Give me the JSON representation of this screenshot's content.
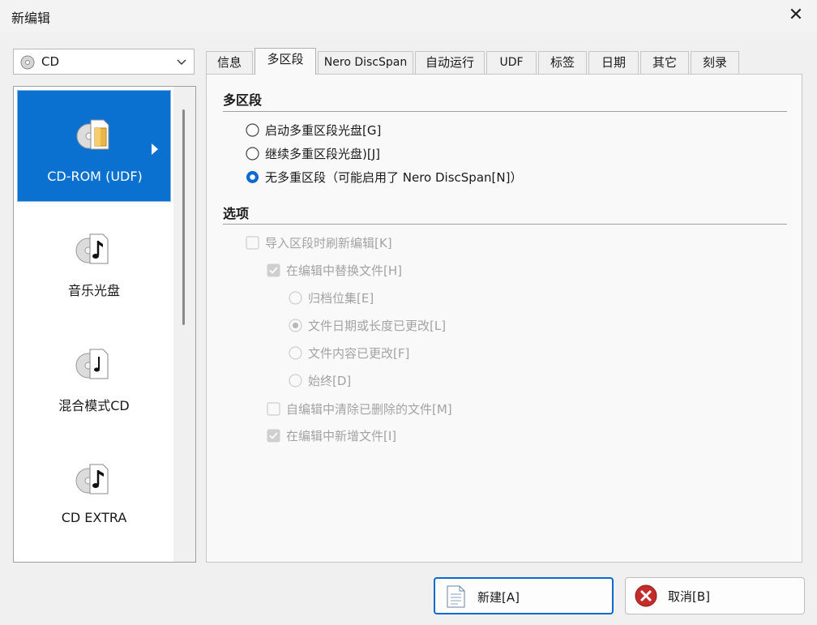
{
  "window": {
    "title": "新编辑",
    "close_symbol": "✕"
  },
  "disc_type": {
    "selected": "CD"
  },
  "categories": [
    {
      "label": "CD-ROM (UDF)",
      "icon": "cd-folder-icon",
      "selected": true
    },
    {
      "label": "音乐光盘",
      "icon": "cd-music-icon",
      "selected": false
    },
    {
      "label": "混合模式CD",
      "icon": "cd-mixed-icon",
      "selected": false
    },
    {
      "label": "CD EXTRA",
      "icon": "cd-extra-icon",
      "selected": false
    }
  ],
  "tabs": [
    "信息",
    "多区段",
    "Nero DiscSpan",
    "自动运行",
    "UDF",
    "标签",
    "日期",
    "其它",
    "刻录"
  ],
  "active_tab": "多区段",
  "multisession": {
    "heading": "多区段",
    "options": [
      {
        "label": "启动多重区段光盘[G]",
        "checked": false
      },
      {
        "label": "继续多重区段光盘)[J]",
        "checked": false
      },
      {
        "label": "无多重区段（可能启用了 Nero DiscSpan[N]）",
        "checked": true
      }
    ]
  },
  "options": {
    "heading": "选项",
    "refresh_on_import": {
      "label": "导入区段时刷新编辑[K]",
      "checked": false
    },
    "replace_files": {
      "label": "在编辑中替换文件[H]",
      "checked": true
    },
    "replace_modes": [
      {
        "label": "归档位集[E]",
        "checked": false
      },
      {
        "label": "文件日期或长度已更改[L]",
        "checked": true
      },
      {
        "label": "文件内容已更改[F]",
        "checked": false
      },
      {
        "label": "始终[D]",
        "checked": false
      }
    ],
    "remove_deleted": {
      "label": "自编辑中清除已删除的文件[M]",
      "checked": false
    },
    "add_new": {
      "label": "在编辑中新增文件[I]",
      "checked": true
    }
  },
  "buttons": {
    "new": "新建[A]",
    "cancel": "取消[B]"
  },
  "colors": {
    "selection": "#0b71d0",
    "accent": "#0b6acf",
    "cancel_icon": "#c42b2b"
  }
}
